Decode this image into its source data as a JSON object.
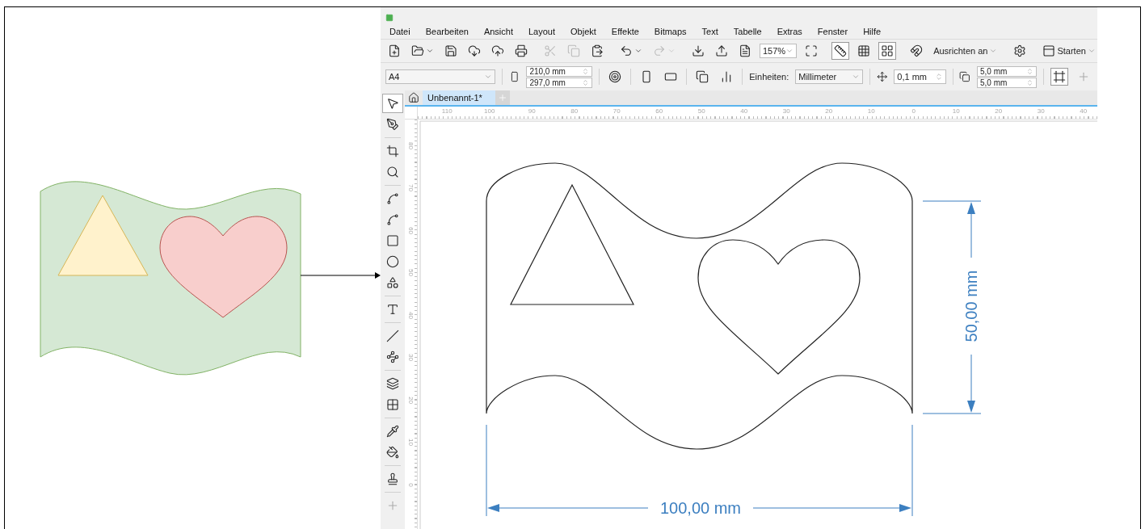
{
  "menu": [
    "Datei",
    "Bearbeiten",
    "Ansicht",
    "Layout",
    "Objekt",
    "Effekte",
    "Bitmaps",
    "Text",
    "Tabelle",
    "Extras",
    "Fenster",
    "Hilfe"
  ],
  "standard_toolbar": {
    "clipboard": [
      {
        "disabled": true
      },
      {
        "disabled": true
      },
      {
        "disabled": false
      }
    ],
    "undo": {
      "disabled": false
    },
    "redo": {
      "disabled": true
    },
    "zoom": "157%",
    "snap_label": "Ausrichten an",
    "launch_label": "Starten"
  },
  "property_bar": {
    "page_size": "A4",
    "width": "210,0 mm",
    "height": "297,0 mm",
    "units_label": "Einheiten:",
    "units": "Millimeter",
    "nudge": "0,1 mm",
    "duplicate_x": "5,0 mm",
    "duplicate_y": "5,0 mm"
  },
  "tabs": [
    {
      "label": "Unbenannt-1*",
      "selected": true
    }
  ],
  "toolbox": [
    [
      {
        "selected": true
      },
      {
        "selected": false
      }
    ],
    [
      {
        "selected": false
      },
      {
        "selected": false
      }
    ],
    [
      {
        "selected": false
      },
      {
        "selected": false
      },
      {
        "selected": false
      },
      {
        "selected": false
      },
      {
        "selected": false
      }
    ],
    [
      {
        "selected": false
      }
    ],
    [
      {
        "selected": false
      },
      {
        "selected": false
      }
    ],
    [
      {
        "selected": false
      },
      {
        "selected": false
      }
    ],
    [
      {
        "selected": false
      },
      {
        "selected": false
      }
    ],
    [
      {
        "selected": false
      }
    ]
  ],
  "rulers": {
    "horizontal": [
      "110",
      "100",
      "90",
      "80",
      "70",
      "60",
      "50",
      "40",
      "30",
      "20",
      "10",
      "0",
      "10",
      "20",
      "30",
      "40"
    ],
    "vertical": [
      "80",
      "70",
      "60",
      "50",
      "40",
      "30",
      "20",
      "10",
      "0"
    ]
  },
  "dimensions": {
    "height": "50,00 mm",
    "width": "100,00 mm"
  }
}
